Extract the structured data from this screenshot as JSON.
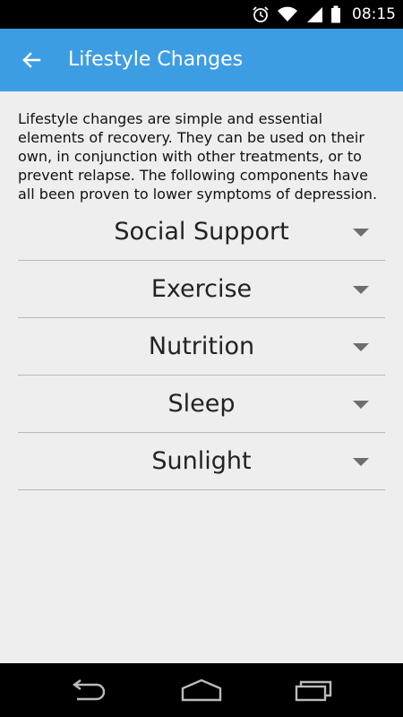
{
  "status_bar": {
    "time": "08:15",
    "icons": [
      "alarm-icon",
      "wifi-icon",
      "signal-icon",
      "battery-icon"
    ]
  },
  "app_bar": {
    "title": "Lifestyle Changes",
    "back_icon": "arrow-left-icon",
    "color": "#3d9de3"
  },
  "intro": {
    "text": "Lifestyle changes are simple and essential elements of recovery. They can be used on their own, in conjunction with other treatments, or to prevent relapse. The following components have all been proven to lower symptoms of depression."
  },
  "sections": [
    {
      "label": "Social Support",
      "icon": "chevron-down-icon"
    },
    {
      "label": "Exercise",
      "icon": "chevron-down-icon"
    },
    {
      "label": "Nutrition",
      "icon": "chevron-down-icon"
    },
    {
      "label": "Sleep",
      "icon": "chevron-down-icon"
    },
    {
      "label": "Sunlight",
      "icon": "chevron-down-icon"
    }
  ],
  "nav_bar": {
    "buttons": [
      "back-nav-icon",
      "home-nav-icon",
      "recents-nav-icon"
    ]
  }
}
